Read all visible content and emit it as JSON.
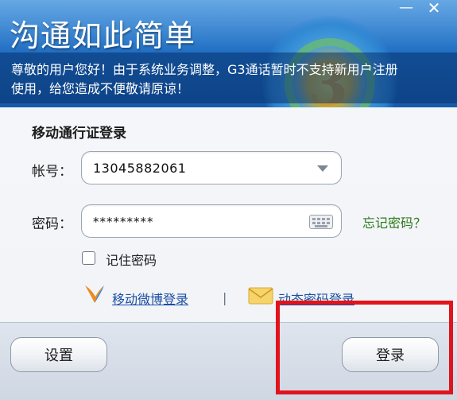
{
  "window": {
    "title": "沟通如此简单",
    "minimize_symbol": "—",
    "close_symbol": "✕",
    "logo_digit": "3"
  },
  "notice": {
    "line1": "尊敬的用户您好！由于系统业务调整，G3通话暂时不支持新用户注册",
    "line2": "使用，给您造成不便敬请原谅！"
  },
  "login": {
    "heading": "移动通行证登录",
    "account_label": "帐号：",
    "account_value": "13045882061",
    "password_label": "密码：",
    "password_value": "*********",
    "forgot_password": "忘记密码？",
    "remember_label": "记住密码",
    "remember_checked": false,
    "weibo_login": "移动微博登录",
    "separator": "|",
    "dynamic_password_login": "动态密码登录"
  },
  "footer": {
    "settings_label": "设置",
    "login_label": "登录"
  },
  "colors": {
    "header_blue": "#1f6fc4",
    "link_blue": "#1d4fa3",
    "forgot_green": "#2b7a1a",
    "highlight_red": "#e0141c"
  },
  "icons": [
    "minimize-icon",
    "close-icon",
    "dropdown-caret-icon",
    "keyboard-icon",
    "weibo-icon",
    "mail-icon"
  ]
}
